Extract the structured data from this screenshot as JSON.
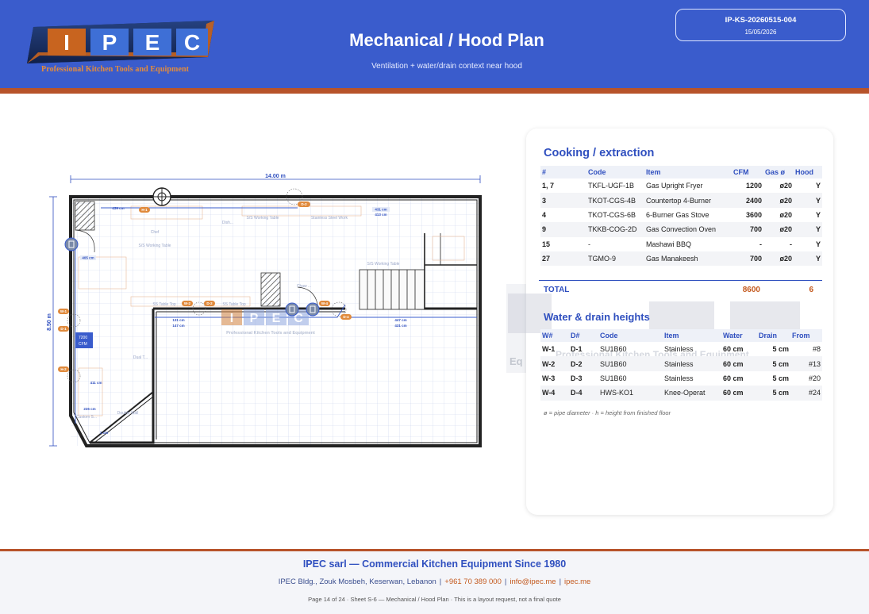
{
  "header": {
    "logo_letters": [
      "I",
      "P",
      "E",
      "C"
    ],
    "logo_tagline": "Professional Kitchen Tools and Equipment",
    "title": "Mechanical / Hood Plan",
    "subtitle": "Ventilation + water/drain context near hood",
    "doc_id": "IP-KS-20260515-004",
    "doc_date": "15/05/2026"
  },
  "plan": {
    "width_label": "14.00 m",
    "height_label": "8.50 m",
    "dims": [
      "405 cm",
      "431 cm",
      "413 cm",
      "131 cm",
      "147 cm",
      "447 cm",
      "431 cm",
      "226 cm",
      "411 cm",
      "1 cm",
      "439 cm"
    ],
    "zone_labels": [
      "S/S Working Table",
      "Dish...",
      "Stainless Steel Work",
      "S/S Working Table",
      "Chef",
      "S/S Working Table",
      "SS Table Top",
      "SS Table Top",
      "Chaw ..."
    ],
    "equipment_text": [
      "Double Wall",
      "Custom S...",
      "Dual T..."
    ],
    "side_box": {
      "line1": "7200",
      "line2": "CFM"
    },
    "tags": [
      "H-1",
      "D-2",
      "W-1",
      "D-1",
      "H-2",
      "W-2",
      "D-2",
      "W-4",
      "D-4"
    ],
    "watermark_letters": [
      "I",
      "P",
      "E",
      "C"
    ],
    "watermark_tagline": "Professional Kitchen Tools and Equipment"
  },
  "cooking": {
    "heading": "Cooking / extraction",
    "columns": [
      "#",
      "Code",
      "Item",
      "CFM",
      "Gas ø",
      "Hood"
    ],
    "rows": [
      {
        "n": "1, 7",
        "code": "TKFL-UGF-1B",
        "item": "Gas Upright Fryer",
        "cfm": "1200",
        "gas": "ø20",
        "hood": "Y"
      },
      {
        "n": "3",
        "code": "TKOT-CGS-4B",
        "item": "Countertop 4-Burner",
        "cfm": "2400",
        "gas": "ø20",
        "hood": "Y"
      },
      {
        "n": "4",
        "code": "TKOT-CGS-6B",
        "item": "6-Burner Gas Stove",
        "cfm": "3600",
        "gas": "ø20",
        "hood": "Y"
      },
      {
        "n": "9",
        "code": "TKKB-COG-2D",
        "item": "Gas Convection Oven",
        "cfm": "700",
        "gas": "ø20",
        "hood": "Y"
      },
      {
        "n": "15",
        "code": "-",
        "item": "Mashawi BBQ",
        "cfm": "-",
        "gas": "-",
        "hood": "Y"
      },
      {
        "n": "27",
        "code": "TGMO-9",
        "item": "Gas Manakeesh",
        "cfm": "700",
        "gas": "ø20",
        "hood": "Y"
      }
    ],
    "total_label": "TOTAL",
    "total_cfm": "8600",
    "total_hood": "6"
  },
  "water": {
    "heading": "Water & drain heights",
    "columns": [
      "W#",
      "D#",
      "Code",
      "Item",
      "Water",
      "Drain",
      "From"
    ],
    "rows": [
      {
        "w": "W-1",
        "d": "D-1",
        "code": "SU1B60",
        "item": "Stainless",
        "water": "60 cm",
        "drain": "5 cm",
        "from": "#8"
      },
      {
        "w": "W-2",
        "d": "D-2",
        "code": "SU1B60",
        "item": "Stainless",
        "water": "60 cm",
        "drain": "5 cm",
        "from": "#13"
      },
      {
        "w": "W-3",
        "d": "D-3",
        "code": "SU1B60",
        "item": "Stainless",
        "water": "60 cm",
        "drain": "5 cm",
        "from": "#20"
      },
      {
        "w": "W-4",
        "d": "D-4",
        "code": "HWS-KO1",
        "item": "Knee-Operat",
        "water": "60 cm",
        "drain": "5 cm",
        "from": "#24"
      }
    ],
    "note": "ø = pipe diameter  ·  h = height from finished floor"
  },
  "card_watermark": {
    "line1": "Eq",
    "line2": "Professional Kitchen Tools and Equipment"
  },
  "footer": {
    "company": "IPEC sarl — Commercial Kitchen Equipment Since 1980",
    "address": "IPEC Bldg., Zouk Mosbeh, Keserwan, Lebanon",
    "phone": "+961 70 389 000",
    "email": "info@ipec.me",
    "web": "ipec.me",
    "page_line": "Page 14 of 24  ·  Sheet S-6 — Mechanical / Hood Plan  ·  This is a layout request, not a final quote"
  },
  "colors": {
    "header_blue": "#3a5ccc",
    "accent_rust": "#b7532a",
    "heading_blue": "#2f4fbf",
    "value_orange": "#c45a1f"
  }
}
